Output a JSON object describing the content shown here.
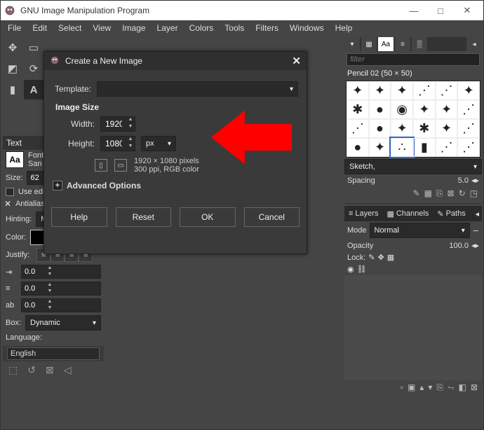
{
  "title": "GNU Image Manipulation Program",
  "menus": [
    "File",
    "Edit",
    "Select",
    "View",
    "Image",
    "Layer",
    "Colors",
    "Tools",
    "Filters",
    "Windows",
    "Help"
  ],
  "dialog": {
    "title": "Create a New Image",
    "template_label": "Template:",
    "template_value": "",
    "section": "Image Size",
    "width_label": "Width:",
    "width_value": "1920",
    "height_label": "Height:",
    "height_value": "1080",
    "units": "px",
    "info_line1": "1920 × 1080 pixels",
    "info_line2": "300 ppi, RGB color",
    "advanced": "Advanced Options",
    "buttons": {
      "help": "Help",
      "reset": "Reset",
      "ok": "OK",
      "cancel": "Cancel"
    }
  },
  "left": {
    "text_label": "Text",
    "font_label": "Font",
    "font_name": "San",
    "size_label": "Size:",
    "size_value": "62",
    "use_editor": "Use edit",
    "antialias": "Antialias",
    "hinting_label": "Hinting:",
    "hinting_value": "Medium",
    "color_label": "Color:",
    "justify_label": "Justify:",
    "indent_defaults": [
      "0.0",
      "0.0",
      "0.0"
    ],
    "box_label": "Box:",
    "box_value": "Dynamic",
    "language_label": "Language:",
    "language_value": "English"
  },
  "right": {
    "filter_placeholder": "filter",
    "brush_name": "Pencil 02 (50 × 50)",
    "sketch_label": "Sketch,",
    "spacing_label": "Spacing",
    "spacing_value": "5.0",
    "tab_layers": "Layers",
    "tab_channels": "Channels",
    "tab_paths": "Paths",
    "mode_label": "Mode",
    "mode_value": "Normal",
    "opacity_label": "Opacity",
    "opacity_value": "100.0",
    "lock_label": "Lock:"
  }
}
